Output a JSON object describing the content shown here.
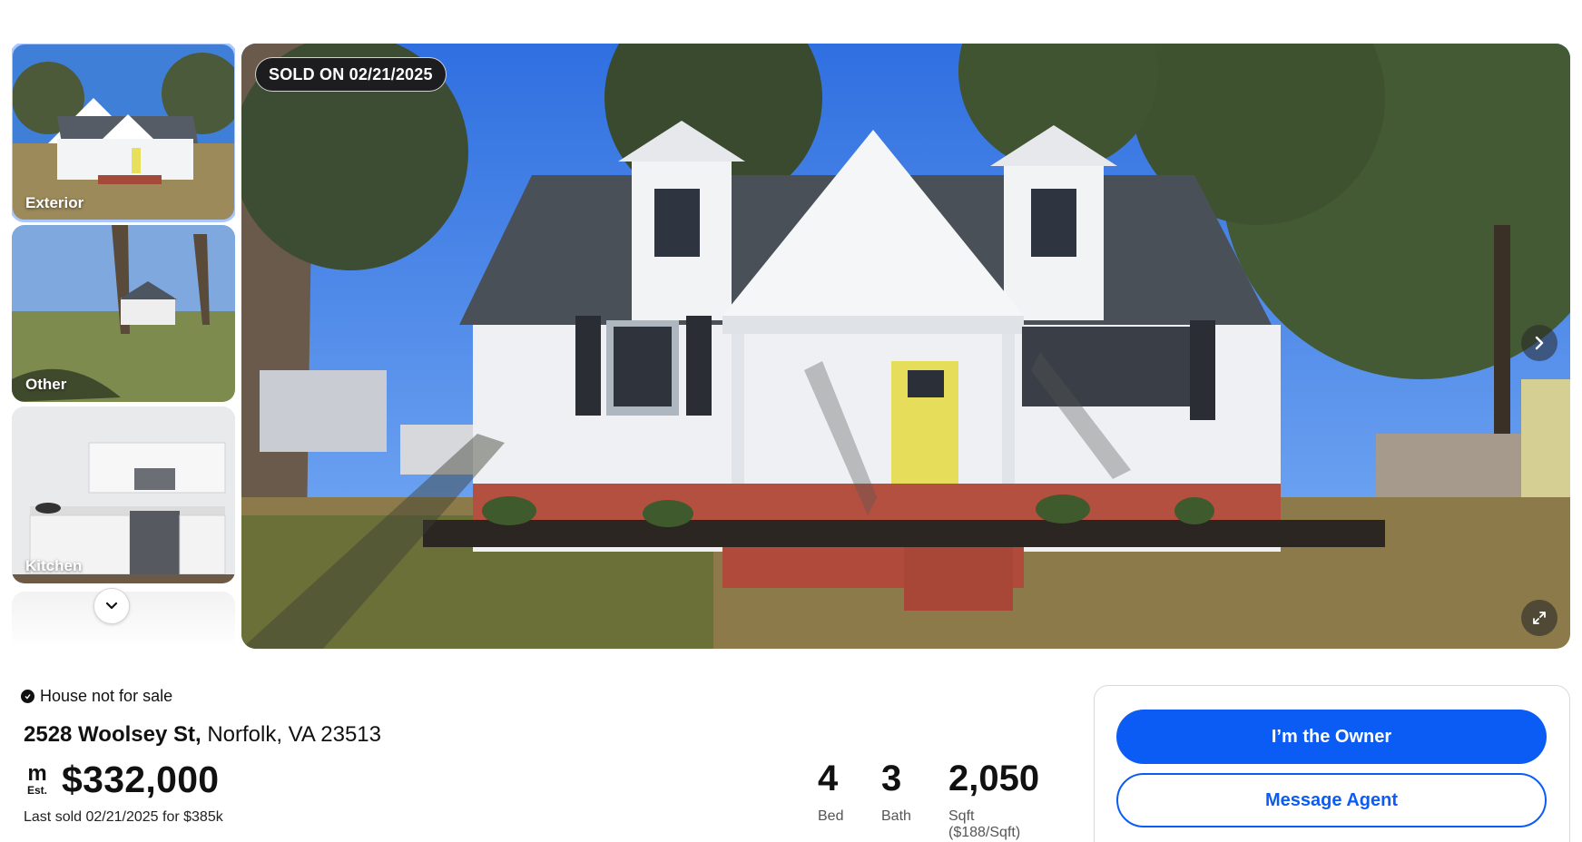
{
  "gallery": {
    "thumbnails": [
      {
        "label": "Exterior"
      },
      {
        "label": "Other"
      },
      {
        "label": "Kitchen"
      }
    ],
    "sold_badge": "SOLD ON 02/21/2025",
    "icons": {
      "scroll_down": "chevron-down-icon",
      "next": "chevron-right-icon",
      "fullscreen": "expand-icon"
    }
  },
  "listing": {
    "status": "House not for sale",
    "street": "2528 Woolsey St,",
    "city_state_zip": "Norfolk, VA 23513",
    "estimate_logo_m": "m",
    "estimate_logo_est": "Est.",
    "price": "$332,000",
    "last_sold": "Last sold 02/21/2025 for $385k",
    "stats": [
      {
        "value": "4",
        "label": "Bed"
      },
      {
        "value": "3",
        "label": "Bath"
      },
      {
        "value": "2,050",
        "label": "Sqft ($188/Sqft)"
      }
    ]
  },
  "contact": {
    "owner_button": "I’m the Owner",
    "message_button": "Message Agent"
  },
  "colors": {
    "accent": "#0a5cf5",
    "badge_bg": "#1d1d1f"
  }
}
